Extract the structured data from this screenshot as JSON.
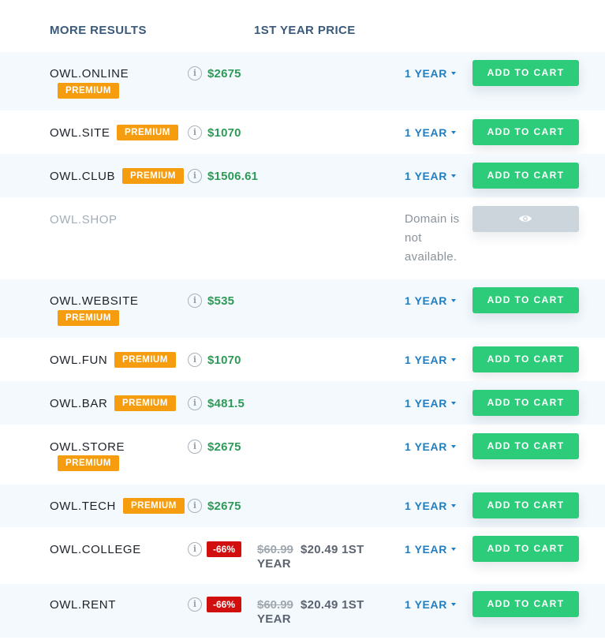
{
  "header": {
    "name_col": "MORE RESULTS",
    "price_col": "1ST YEAR PRICE"
  },
  "labels": {
    "premium": "PREMIUM",
    "add_to_cart": "ADD TO CART",
    "info": "i"
  },
  "results": [
    {
      "domain": "OWL.ONLINE",
      "premium": true,
      "price": "$2675",
      "period": "1 YEAR"
    },
    {
      "domain": "OWL.SITE",
      "premium": true,
      "price": "$1070",
      "period": "1 YEAR"
    },
    {
      "domain": "OWL.CLUB",
      "premium": true,
      "price": "$1506.61",
      "period": "1 YEAR"
    },
    {
      "domain": "OWL.SHOP",
      "available": false,
      "message": "Domain is not available."
    },
    {
      "domain": "OWL.WEBSITE",
      "premium": true,
      "price": "$535",
      "period": "1 YEAR"
    },
    {
      "domain": "OWL.FUN",
      "premium": true,
      "price": "$1070",
      "period": "1 YEAR"
    },
    {
      "domain": "OWL.BAR",
      "premium": true,
      "price": "$481.5",
      "period": "1 YEAR"
    },
    {
      "domain": "OWL.STORE",
      "premium": true,
      "price": "$2675",
      "period": "1 YEAR"
    },
    {
      "domain": "OWL.TECH",
      "premium": true,
      "price": "$2675",
      "period": "1 YEAR"
    },
    {
      "domain": "OWL.COLLEGE",
      "discount": "-66%",
      "old_price": "$60.99",
      "new_price": "$20.49 1ST YEAR",
      "period": "1 YEAR"
    },
    {
      "domain": "OWL.RENT",
      "discount": "-66%",
      "old_price": "$60.99",
      "new_price": "$20.49 1ST YEAR",
      "period": "1 YEAR"
    }
  ],
  "colors": {
    "accent_green": "#2ccc7a",
    "premium_orange": "#f59d0e",
    "discount_red": "#d10f0f",
    "link_blue": "#1e7fc2",
    "price_green": "#2e9a58"
  }
}
